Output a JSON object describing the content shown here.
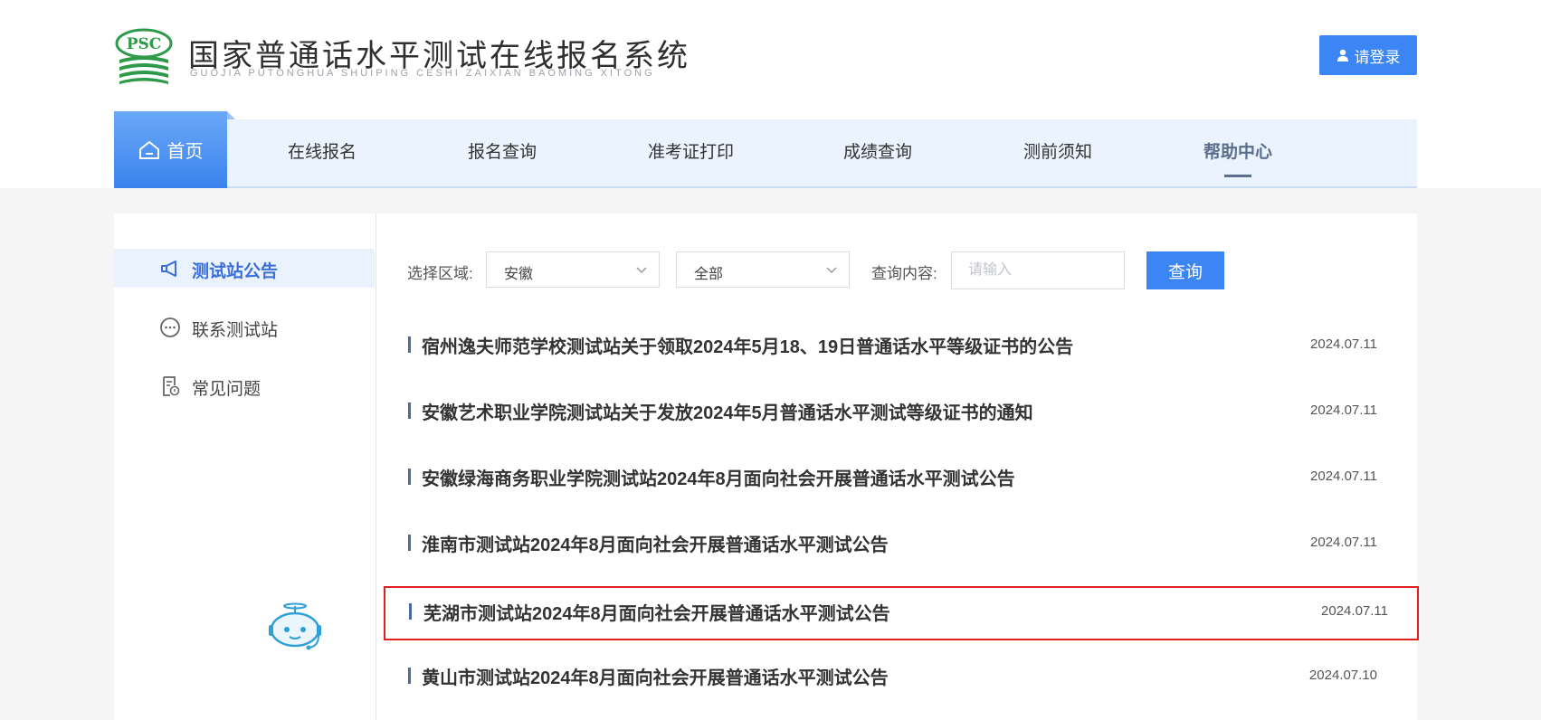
{
  "header": {
    "logo_badge": "PSC",
    "logo_title": "国家普通话水平测试在线报名系统",
    "logo_subtitle": "GUOJIA PUTONGHUA SHUIPING CESHI ZAIXIAN BAOMING XITONG",
    "login_label": "请登录",
    "brand_color": "#3b85f4"
  },
  "nav": {
    "home": "首页",
    "items": [
      "在线报名",
      "报名查询",
      "准考证打印",
      "成绩查询",
      "测前须知",
      "帮助中心"
    ],
    "active": "帮助中心"
  },
  "sidebar": {
    "items": [
      {
        "label": "测试站公告",
        "icon": "megaphone-icon"
      },
      {
        "label": "联系测试站",
        "icon": "chat-bubble-icon"
      },
      {
        "label": "常见问题",
        "icon": "document-icon"
      }
    ],
    "active": "测试站公告"
  },
  "filter": {
    "region_label": "选择区域:",
    "region_value": "安徽",
    "type_value": "全部",
    "query_label": "查询内容:",
    "query_placeholder": "请输入",
    "search_label": "查询"
  },
  "notices": [
    {
      "title": "宿州逸夫师范学校测试站关于领取2024年5月18、19日普通话水平等级证书的公告",
      "date": "2024.07.11"
    },
    {
      "title": "安徽艺术职业学院测试站关于发放2024年5月普通话水平测试等级证书的通知",
      "date": "2024.07.11"
    },
    {
      "title": "安徽绿海商务职业学院测试站2024年8月面向社会开展普通话水平测试公告",
      "date": "2024.07.11"
    },
    {
      "title": "淮南市测试站2024年8月面向社会开展普通话水平测试公告",
      "date": "2024.07.11"
    },
    {
      "title": "芜湖市测试站2024年8月面向社会开展普通话水平测试公告",
      "date": "2024.07.11"
    },
    {
      "title": "黄山市测试站2024年8月面向社会开展普通话水平测试公告",
      "date": "2024.07.10"
    }
  ]
}
